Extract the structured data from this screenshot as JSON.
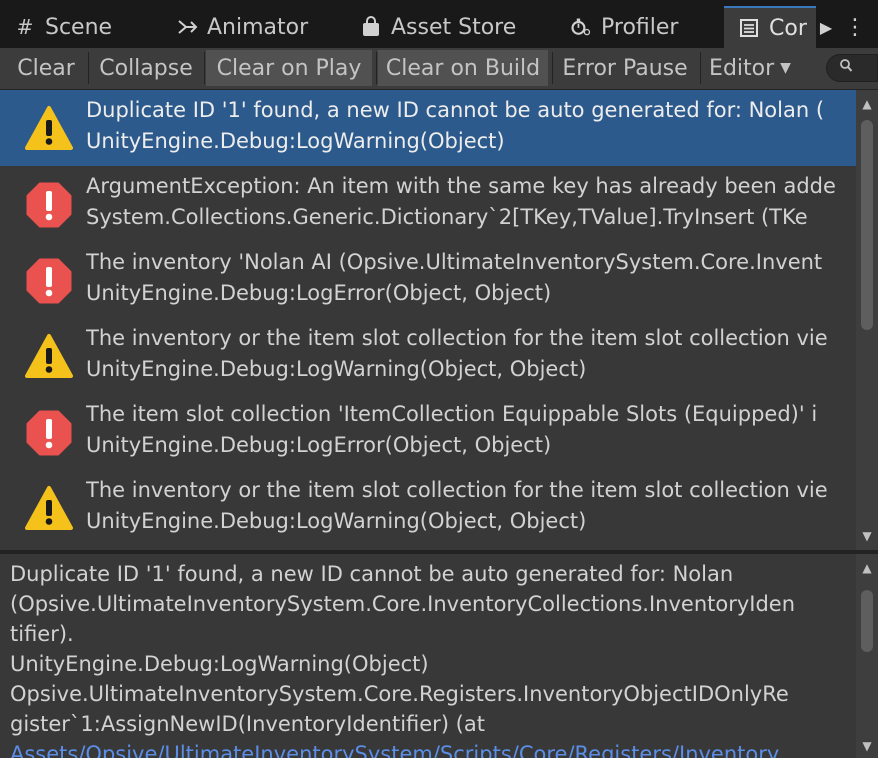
{
  "tabs": [
    {
      "label": "Scene",
      "icon": "hash-icon"
    },
    {
      "label": "Animator",
      "icon": "animator-icon"
    },
    {
      "label": "Asset Store",
      "icon": "store-bag-icon"
    },
    {
      "label": "Profiler",
      "icon": "profiler-icon"
    },
    {
      "label": "Cor",
      "icon": "console-icon"
    }
  ],
  "toolbar": {
    "clear": "Clear",
    "collapse": "Collapse",
    "clear_on_play": "Clear on Play",
    "clear_on_build": "Clear on Build",
    "error_pause": "Error Pause",
    "editor": "Editor",
    "editor_arrow": "▼"
  },
  "colors": {
    "accent": "#2d5a8c",
    "warning": "#f4c21b",
    "error": "#e9524f",
    "link": "#5b8ee6"
  },
  "logs": [
    {
      "type": "warning",
      "selected": true,
      "line1": "Duplicate ID '1' found, a new ID cannot be auto generated for: Nolan (",
      "line2": "UnityEngine.Debug:LogWarning(Object)"
    },
    {
      "type": "error",
      "selected": false,
      "line1": "ArgumentException: An item with the same key has already been adde",
      "line2": "System.Collections.Generic.Dictionary`2[TKey,TValue].TryInsert (TKe"
    },
    {
      "type": "error",
      "selected": false,
      "line1": "The inventory 'Nolan AI (Opsive.UltimateInventorySystem.Core.Invent",
      "line2": "UnityEngine.Debug:LogError(Object, Object)"
    },
    {
      "type": "warning",
      "selected": false,
      "line1": "The inventory or the item slot collection for the item slot collection vie",
      "line2": "UnityEngine.Debug:LogWarning(Object, Object)"
    },
    {
      "type": "error",
      "selected": false,
      "line1": "The item slot collection 'ItemCollection Equippable Slots (Equipped)' i",
      "line2": "UnityEngine.Debug:LogError(Object, Object)"
    },
    {
      "type": "warning",
      "selected": false,
      "line1": "The inventory or the item slot collection for the item slot collection vie",
      "line2": "UnityEngine.Debug:LogWarning(Object, Object)"
    }
  ],
  "details": {
    "lines": [
      {
        "text": "Duplicate ID '1' found, a new ID cannot be auto generated for: Nolan",
        "link": false
      },
      {
        "text": "(Opsive.UltimateInventorySystem.Core.InventoryCollections.InventoryIden",
        "link": false
      },
      {
        "text": "tifier).",
        "link": false
      },
      {
        "text": "UnityEngine.Debug:LogWarning(Object)",
        "link": false
      },
      {
        "text": "Opsive.UltimateInventorySystem.Core.Registers.InventoryObjectIDOnlyRe",
        "link": false
      },
      {
        "text": "gister`1:AssignNewID(InventoryIdentifier) (at",
        "link": false
      },
      {
        "text": "Assets/Opsive/UltimateInventorySystem/Scripts/Core/Registers/Inventory",
        "link": true
      }
    ]
  }
}
